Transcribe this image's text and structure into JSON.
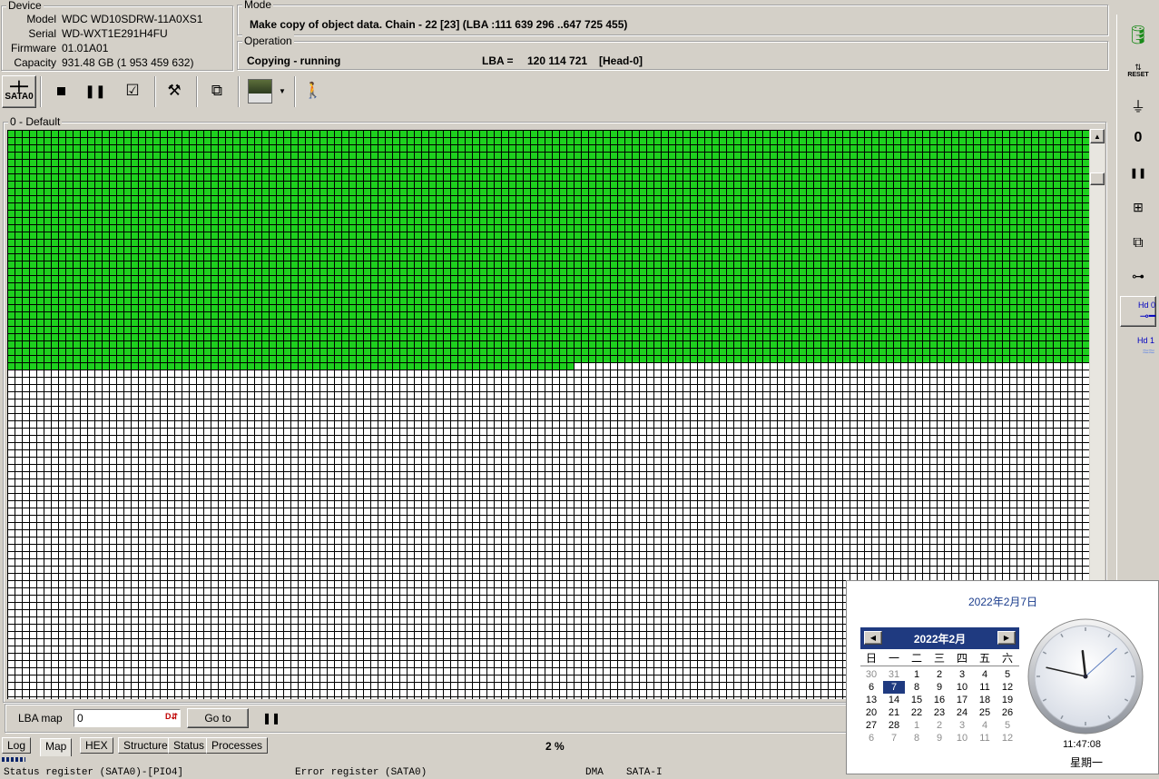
{
  "device": {
    "legend": "Device",
    "model_label": "Model",
    "model": "WDC WD10SDRW-11A0XS1",
    "serial_label": "Serial",
    "serial": "WD-WXT1E291H4FU",
    "firmware_label": "Firmware",
    "firmware": "01.01A01",
    "capacity_label": "Capacity",
    "capacity": "931.48 GB (1 953 459 632)"
  },
  "mode": {
    "legend": "Mode",
    "text": "Make copy of object data. Chain - 22 [23] (LBA :111 639 296 ..647 725 455)"
  },
  "operation": {
    "legend": "Operation",
    "status": "Copying - running",
    "lba_label": "LBA =",
    "lba_value": "120 114 721",
    "head": "[Head-0]"
  },
  "toolbar": {
    "port_label": "SATA0",
    "icons": [
      "port-icon",
      "stop-icon",
      "pause-icon",
      "check-icon",
      "tools-icon",
      "copy-icon",
      "map-view-icon",
      "dropdown-icon",
      "walk-icon"
    ]
  },
  "map": {
    "legend": "0 - Default",
    "progress": 0.417,
    "colors": {
      "done": "#1ed01e",
      "pending": "#ffffff"
    }
  },
  "bottom_bar": {
    "lba_map_label": "LBA map",
    "lba_input_value": "0",
    "goto_label": "Go to",
    "percent": "2 %"
  },
  "tabs": [
    {
      "label": "Log",
      "active": false
    },
    {
      "label": "Map",
      "active": true
    },
    {
      "label": "HEX",
      "active": false
    },
    {
      "label": "Structure",
      "active": false
    },
    {
      "label": "Status",
      "active": false
    },
    {
      "label": "Processes",
      "active": false
    }
  ],
  "status_line": {
    "status_register": "Status register (SATA0)-[PIO4]",
    "error_register": "Error register (SATA0)",
    "dma": "DMA",
    "sata": "SATA-I"
  },
  "right_toolbar": {
    "reset_label": "RESET",
    "hd0_label": "Hd 0",
    "hd1_label": "Hd 1"
  },
  "calendar": {
    "date_title": "2022年2月7日",
    "month_title": "2022年2月",
    "weekdays": [
      "日",
      "一",
      "二",
      "三",
      "四",
      "五",
      "六"
    ],
    "weeks": [
      [
        "30",
        "31",
        "1",
        "2",
        "3",
        "4",
        "5"
      ],
      [
        "6",
        "7",
        "8",
        "9",
        "10",
        "11",
        "12"
      ],
      [
        "13",
        "14",
        "15",
        "16",
        "17",
        "18",
        "19"
      ],
      [
        "20",
        "21",
        "22",
        "23",
        "24",
        "25",
        "26"
      ],
      [
        "27",
        "28",
        "1",
        "2",
        "3",
        "4",
        "5"
      ],
      [
        "6",
        "7",
        "8",
        "9",
        "10",
        "11",
        "12"
      ]
    ],
    "selected": "7",
    "time": "11:47:08",
    "weekday_name": "星期一"
  }
}
